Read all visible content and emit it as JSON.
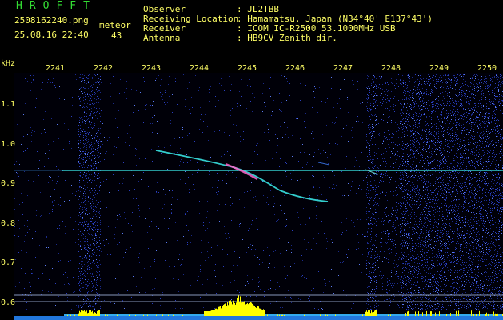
{
  "header": {
    "title": "HROFFT",
    "filename": "2508162240.png",
    "datetime": "25.08.16 22:40",
    "meteor_label": "meteor",
    "meteor_count": "43",
    "observer_label": "Observer",
    "location_label": "Receiving Location",
    "receiver_label": "Receiver",
    "antenna_label": "Antenna",
    "observer_value": ": JL2TBB",
    "location_value": ": Hamamatsu, Japan (N34°40' E137°43')",
    "receiver_value": ": ICOM IC-R2500 53.1000MHz USB",
    "antenna_value": ": HB9CV Zenith dir."
  },
  "axis": {
    "y_unit": "kHz",
    "x_ticks": [
      "2241",
      "2242",
      "2243",
      "2244",
      "2245",
      "2246",
      "2247",
      "2248",
      "2249",
      "2250"
    ],
    "y_ticks": [
      "1.1",
      "1.0",
      "0.9",
      "0.8",
      "0.7",
      "0.6"
    ]
  },
  "colors": {
    "text": "#ffff66",
    "title": "#33dd33",
    "noise": "#1a2a8a",
    "carrier": "#33cccc",
    "level": "#ffff00",
    "baseline": "#33aaee"
  }
}
